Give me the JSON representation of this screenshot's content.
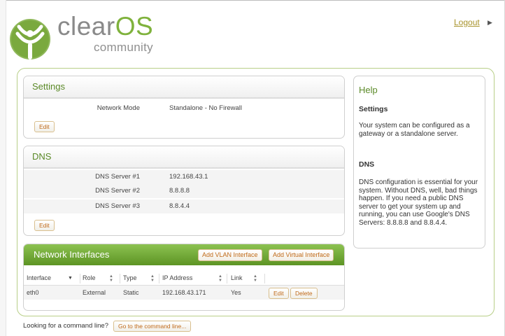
{
  "header": {
    "brand_part1": "clear",
    "brand_part2": "OS",
    "tagline": "community",
    "logout_label": "Logout",
    "logout_arrow": "▶"
  },
  "settings": {
    "title": "Settings",
    "network_mode_label": "Network Mode",
    "network_mode_value": "Standalone - No Firewall",
    "edit_label": "Edit"
  },
  "dns": {
    "title": "DNS",
    "servers": [
      {
        "label": "DNS Server #1",
        "value": "192.168.43.1"
      },
      {
        "label": "DNS Server #2",
        "value": "8.8.8.8"
      },
      {
        "label": "DNS Server #3",
        "value": "8.8.4.4"
      }
    ],
    "edit_label": "Edit"
  },
  "network_interfaces": {
    "title": "Network Interfaces",
    "add_vlan_label": "Add VLAN Interface",
    "add_virtual_label": "Add Virtual Interface",
    "columns": [
      "Interface",
      "Role",
      "Type",
      "IP Address",
      "Link"
    ],
    "rows": [
      {
        "interface": "eth0",
        "role": "External",
        "type": "Static",
        "ip": "192.168.43.171",
        "link": "Yes",
        "edit_label": "Edit",
        "delete_label": "Delete"
      }
    ]
  },
  "help": {
    "title": "Help",
    "settings_heading": "Settings",
    "settings_text": "Your system can be configured as a gateway or a standalone server.",
    "dns_heading": "DNS",
    "dns_text": "DNS configuration is essential for your system. Without DNS, well, bad things happen. If you need a public DNS server to get your system up and running, you can use Google's DNS Servers: 8.8.8.8 and 8.8.4.4."
  },
  "footer": {
    "question": "Looking for a command line?",
    "button_label": "Go to the command line..."
  },
  "colors": {
    "brand_green": "#7fb23c",
    "header_green": "#5b8a28",
    "button_text": "#c06a1a"
  },
  "icons": [
    "clearos-logo-icon",
    "sort-icon",
    "filter-icon",
    "arrow-right-icon"
  ]
}
